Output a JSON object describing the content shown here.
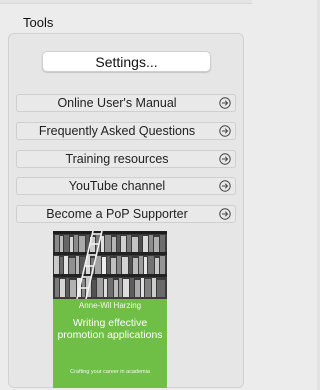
{
  "section": {
    "title": "Tools"
  },
  "settings_button": {
    "label": "Settings..."
  },
  "links": [
    {
      "label": "Online User's Manual",
      "icon": "circle-arrow-right-icon"
    },
    {
      "label": "Frequently Asked Questions",
      "icon": "circle-arrow-right-icon"
    },
    {
      "label": "Training resources",
      "icon": "circle-arrow-right-icon"
    },
    {
      "label": "YouTube channel",
      "icon": "circle-arrow-right-icon"
    },
    {
      "label": "Become a PoP Supporter",
      "icon": "circle-arrow-right-icon"
    }
  ],
  "book": {
    "author": "Anne-Wil Harzing",
    "title": "Writing effective promotion applications",
    "subtitle": "Crafting your career in academia",
    "cover_color": "#6fbe46"
  }
}
